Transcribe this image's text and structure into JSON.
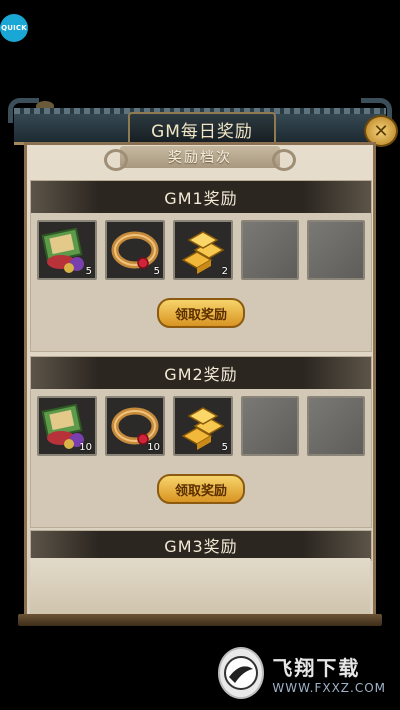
{
  "overlay": {
    "quick_label": "QUICK"
  },
  "dialog": {
    "title": "GM每日奖励",
    "subheader": "奖励档次",
    "sections": [
      {
        "heading": "GM1奖励",
        "button": "领取奖励",
        "slots": [
          {
            "icon": "gift-bundle-icon",
            "qty": "5"
          },
          {
            "icon": "ring-icon",
            "qty": "5"
          },
          {
            "icon": "gold-bars-icon",
            "qty": "2"
          },
          {
            "icon": "empty-slot",
            "qty": ""
          },
          {
            "icon": "empty-slot",
            "qty": ""
          }
        ]
      },
      {
        "heading": "GM2奖励",
        "button": "领取奖励",
        "slots": [
          {
            "icon": "gift-bundle-icon",
            "qty": "10"
          },
          {
            "icon": "ring-icon",
            "qty": "10"
          },
          {
            "icon": "gold-bars-icon",
            "qty": "5"
          },
          {
            "icon": "empty-slot",
            "qty": ""
          },
          {
            "icon": "empty-slot",
            "qty": ""
          }
        ]
      },
      {
        "heading": "GM3奖励"
      }
    ]
  },
  "watermark": {
    "brand": "飞翔下载",
    "url": "WWW.FXXZ.COM"
  },
  "colors": {
    "accent_gold": "#f7d46b",
    "panel_bg": "#e6ddcc",
    "header_dark": "#2b2620",
    "quick_blue": "#1aa7d6"
  }
}
